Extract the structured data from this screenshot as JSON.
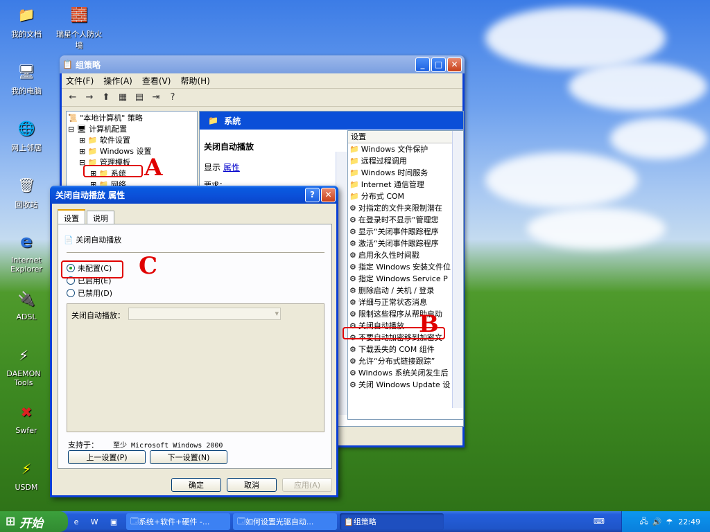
{
  "desktop": {
    "icons": [
      {
        "label": "我的文档",
        "glyph": "📁"
      },
      {
        "label": "瑞星个人防火墙",
        "glyph": "🧱"
      },
      {
        "label": "我的电脑",
        "glyph": "🖥"
      },
      {
        "label": "网上邻居",
        "glyph": "🌐"
      },
      {
        "label": "回收站",
        "glyph": "🗑"
      },
      {
        "label": "Internet Explorer",
        "glyph": "e"
      },
      {
        "label": "ADSL",
        "glyph": "🔌"
      },
      {
        "label": "DAEMON Tools",
        "glyph": "⚡"
      },
      {
        "label": "Swfer",
        "glyph": "✖"
      },
      {
        "label": "USDM",
        "glyph": "⚡"
      }
    ]
  },
  "gp_window": {
    "title": "组策略",
    "menu": [
      "文件(F)",
      "操作(A)",
      "查看(V)",
      "帮助(H)"
    ],
    "tree": [
      "\"本地计算机\" 策略",
      "计算机配置",
      "软件设置",
      "Windows 设置",
      "管理模板",
      "系统",
      "网络"
    ],
    "right_header": "系统",
    "detail_title": "关闭自动播放",
    "detail_show": "显示",
    "detail_link": "属性",
    "detail_req": "要求：",
    "list_header": "设置",
    "list": [
      "Windows 文件保护",
      "远程过程调用",
      "Windows 时间服务",
      "Internet 通信管理",
      "分布式 COM",
      "对指定的文件夹限制潜在",
      "在登录时不显示“管理您",
      "显示“关闭事件跟踪程序",
      "激活“关闭事件跟踪程序",
      "启用永久性时间戳",
      "指定 Windows 安装文件位",
      "指定 Windows Service P",
      "删除启动 / 关机 / 登录",
      "详细与正常状态消息",
      "限制这些程序从帮助启动",
      "关闭自动播放",
      "不要自动加密移到加密文",
      "下载丢失的 COM 组件",
      "允许“分布式链接跟踪”",
      "Windows 系统关闭发生后",
      "关闭 Windows Update 设"
    ]
  },
  "dialog": {
    "title": "关闭自动播放 属性",
    "tabs": [
      "设置",
      "说明"
    ],
    "heading": "关闭自动播放",
    "radios": [
      "未配置(C)",
      "已启用(E)",
      "已禁用(D)"
    ],
    "selected": 0,
    "field_label": "关闭自动播放：",
    "support_label": "支持于：",
    "support_value": "至少 Microsoft Windows 2000",
    "prev": "上一设置(P)",
    "next": "下一设置(N)",
    "ok": "确定",
    "cancel": "取消",
    "apply": "应用(A)"
  },
  "annotations": {
    "a": "A",
    "b": "B",
    "c": "C"
  },
  "taskbar": {
    "start": "开始",
    "tasks": [
      "系统+软件+硬件 -...",
      "如何设置光驱自动...",
      "组策略"
    ],
    "clock": "22:49"
  }
}
